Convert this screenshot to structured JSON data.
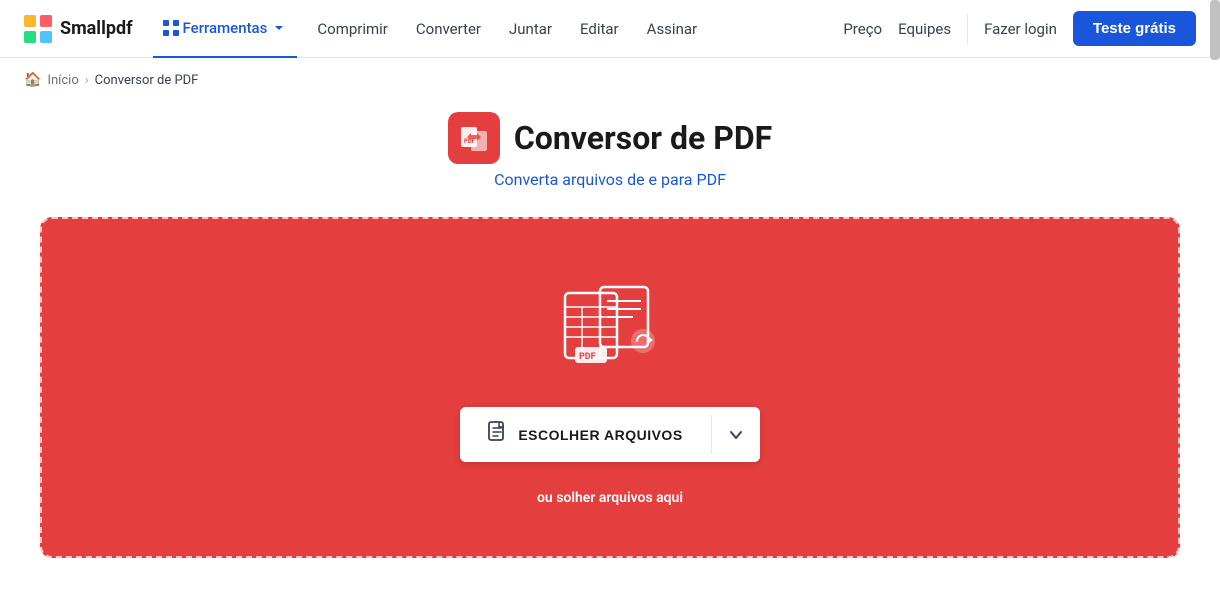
{
  "brand": {
    "name": "Smallpdf"
  },
  "nav": {
    "ferramentas_label": "Ferramentas",
    "links": [
      {
        "label": "Comprimir",
        "id": "comprimir"
      },
      {
        "label": "Converter",
        "id": "converter"
      },
      {
        "label": "Juntar",
        "id": "juntar"
      },
      {
        "label": "Editar",
        "id": "editar"
      },
      {
        "label": "Assinar",
        "id": "assinar"
      }
    ],
    "price_label": "Preço",
    "teams_label": "Equipes",
    "login_label": "Fazer login",
    "trial_label": "Teste grátis"
  },
  "breadcrumb": {
    "home": "Início",
    "current": "Conversor de PDF"
  },
  "page": {
    "title": "Conversor de PDF",
    "subtitle": "Converta arquivos de e para PDF",
    "drop_hint": "ou solher arquivos aqui",
    "choose_label": "ESCOLHER ARQUIVOS"
  }
}
